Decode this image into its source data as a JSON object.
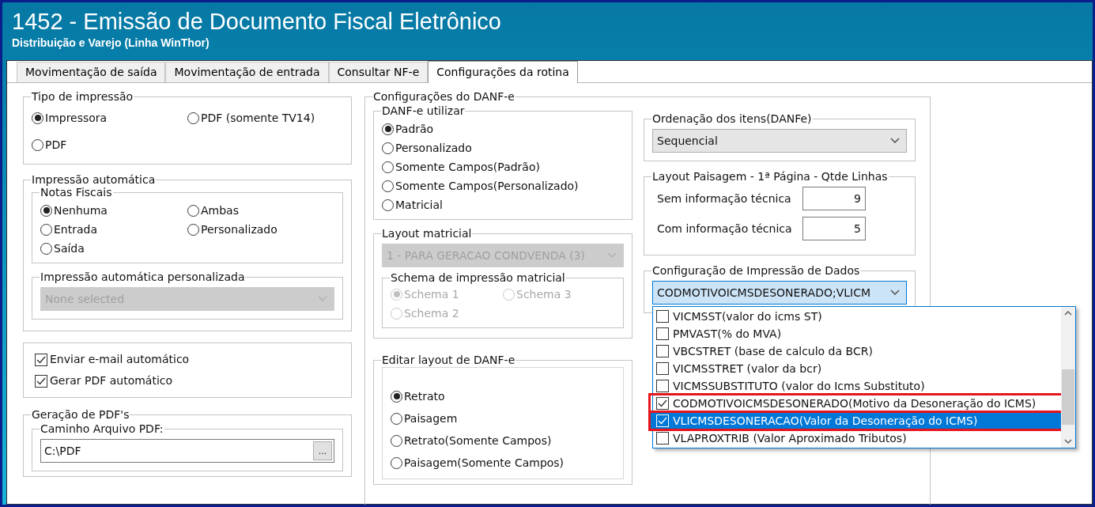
{
  "window": {
    "title": "1452 - Emissão de Documento Fiscal Eletrônico",
    "subtitle": "Distribuição e Varejo (Linha WinThor)"
  },
  "tabs": [
    {
      "label": "Movimentação de saída",
      "selected": false
    },
    {
      "label": "Movimentação de entrada",
      "selected": false
    },
    {
      "label": "Consultar NF-e",
      "selected": false
    },
    {
      "label": "Configurações da rotina",
      "selected": true
    }
  ],
  "print_type": {
    "legend": "Tipo de impressão",
    "options": [
      {
        "label": "Impressora",
        "selected": true
      },
      {
        "label": "PDF (somente TV14)",
        "selected": false
      },
      {
        "label": "PDF",
        "selected": false
      }
    ]
  },
  "auto_print": {
    "legend": "Impressão automática",
    "invoices": {
      "legend": "Notas Fiscais",
      "options": [
        {
          "label": "Nenhuma",
          "selected": true
        },
        {
          "label": "Ambas",
          "selected": false
        },
        {
          "label": "Entrada",
          "selected": false
        },
        {
          "label": "Personalizado",
          "selected": false
        },
        {
          "label": "Saída",
          "selected": false
        }
      ]
    },
    "custom": {
      "legend": "Impressão automática personalizada",
      "select": {
        "value": "None selected",
        "disabled": true
      }
    }
  },
  "auto_options": [
    {
      "label": "Enviar e-mail automático",
      "checked": true
    },
    {
      "label": "Gerar PDF automático",
      "checked": true
    }
  ],
  "pdf_generation": {
    "legend": "Geração de PDF's",
    "path": {
      "legend": "Caminho Arquivo PDF:",
      "value": "C:\\PDF",
      "browse": "..."
    }
  },
  "danfe": {
    "legend": "Configurações do DANF-e",
    "use": {
      "legend": "DANF-e utilizar",
      "options": [
        {
          "label": "Padrão",
          "selected": true
        },
        {
          "label": "Personalizado",
          "selected": false
        },
        {
          "label": "Somente Campos(Padrão)",
          "selected": false
        },
        {
          "label": "Somente Campos(Personalizado)",
          "selected": false
        },
        {
          "label": "Matricial",
          "selected": false
        }
      ]
    },
    "matrix_layout": {
      "legend": "Layout matricial",
      "select": {
        "value": "1 - PARA GERACAO CONDVENDA (3)",
        "disabled": true
      },
      "schema": {
        "legend": "Schema de impressão matricial",
        "disabled": true,
        "options": [
          {
            "label": "Schema 1",
            "selected": true
          },
          {
            "label": "Schema 3",
            "selected": false
          },
          {
            "label": "Schema 2",
            "selected": false
          }
        ]
      }
    },
    "edit_layout": {
      "legend": "Editar layout de DANF-e",
      "options": [
        {
          "label": "Retrato",
          "selected": true
        },
        {
          "label": "Paisagem",
          "selected": false
        },
        {
          "label": "Retrato(Somente Campos)",
          "selected": false
        },
        {
          "label": "Paisagem(Somente Campos)",
          "selected": false
        }
      ]
    },
    "item_order": {
      "legend": "Ordenação dos itens(DANFe)",
      "select": {
        "value": "Sequencial",
        "disabled": false
      }
    },
    "landscape": {
      "legend": "Layout Paisagem - 1ª Página - Qtde Linhas",
      "fields": [
        {
          "label": "Sem informação técnica",
          "value": "9"
        },
        {
          "label": "Com informação técnica",
          "value": "5"
        }
      ]
    },
    "data_print": {
      "legend": "Configuração de Impressão de Dados",
      "select": {
        "value": "CODMOTIVOICMSDESONERADO;VLICM",
        "focused": true
      },
      "list": [
        {
          "label": "VICMSST(valor do icms ST)",
          "checked": false,
          "selected": false,
          "highlighted": false
        },
        {
          "label": "PMVAST(% do MVA)",
          "checked": false,
          "selected": false,
          "highlighted": false
        },
        {
          "label": "VBCSTRET (base de calculo da BCR)",
          "checked": false,
          "selected": false,
          "highlighted": false
        },
        {
          "label": "VICMSSTRET (valor da bcr)",
          "checked": false,
          "selected": false,
          "highlighted": false
        },
        {
          "label": "VICMSSUBSTITUTO (valor do Icms Substituto)",
          "checked": false,
          "selected": false,
          "highlighted": false
        },
        {
          "label": "CODMOTIVOICMSDESONERADO(Motivo da Desoneração do ICMS)",
          "checked": true,
          "selected": false,
          "highlighted": true
        },
        {
          "label": "VLICMSDESONERACAO(Valor da Desoneração do ICMS)",
          "checked": true,
          "selected": true,
          "highlighted": true
        },
        {
          "label": "VLAPROXTRIB (Valor Aproximado Tributos)",
          "checked": false,
          "selected": false,
          "highlighted": false
        }
      ]
    }
  }
}
